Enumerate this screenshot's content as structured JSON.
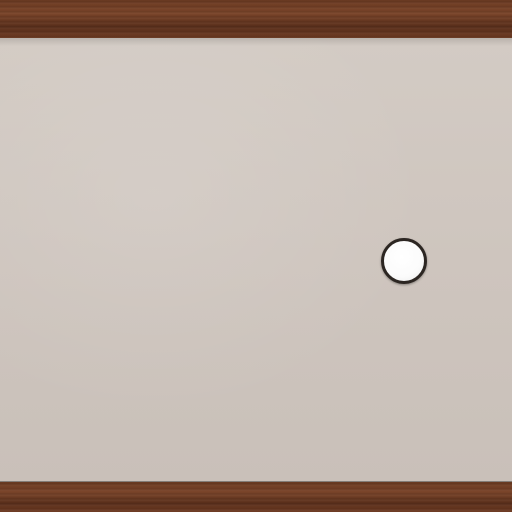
{
  "scene": {
    "colors": {
      "wall": "#cfc6bf",
      "wood_trim": "#6b3a22",
      "light_lens": "#ffffff",
      "light_rim": "#2c2622"
    },
    "elements": {
      "top_trim": "wood-beam",
      "bottom_trim": "wood-beam",
      "fixture": "round-wall-light"
    }
  }
}
